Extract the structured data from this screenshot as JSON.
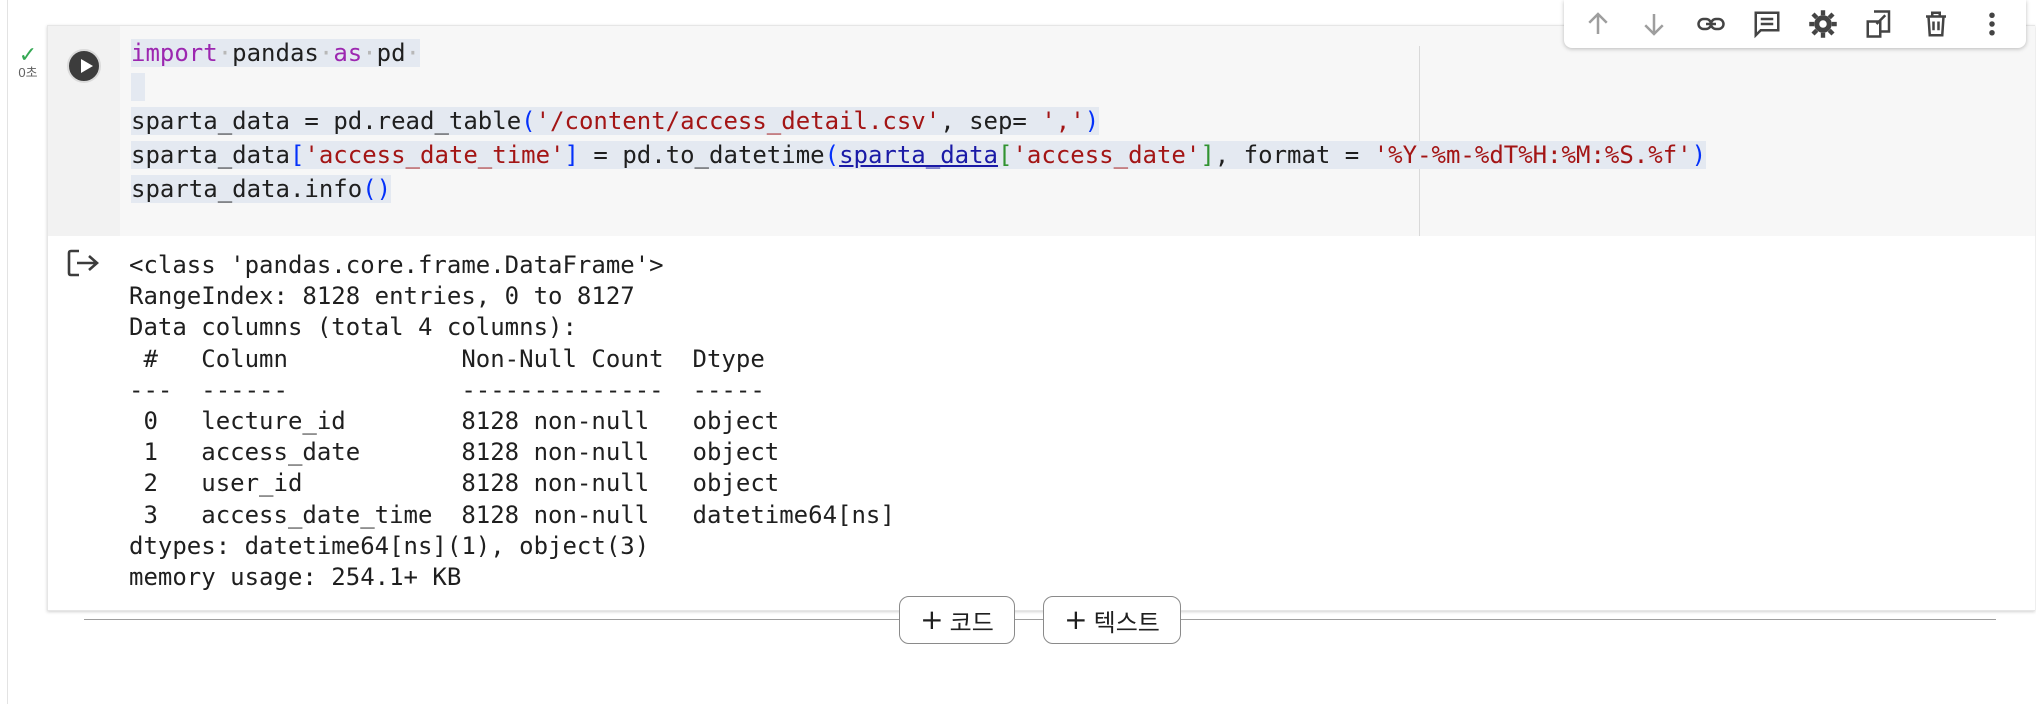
{
  "execution": {
    "status_glyph": "✓",
    "time": "0초"
  },
  "toolbar": {
    "items": [
      {
        "name": "move-up-icon"
      },
      {
        "name": "move-down-icon"
      },
      {
        "name": "link-icon"
      },
      {
        "name": "comment-icon"
      },
      {
        "name": "settings-icon"
      },
      {
        "name": "mirror-cell-icon"
      },
      {
        "name": "delete-icon"
      },
      {
        "name": "more-icon"
      }
    ]
  },
  "code": {
    "line1": {
      "kw1": "import",
      "mod": "pandas",
      "kw2": "as",
      "alias": "pd"
    },
    "line3": {
      "var": "sparta_data",
      "eq": " = ",
      "call": "pd.read_table",
      "open": "(",
      "str1": "'/content/access_detail.csv'",
      "mid": ", sep= ",
      "str2": "','",
      "close": ")"
    },
    "line4": {
      "var": "sparta_data",
      "b1": "[",
      "key": "'access_date_time'",
      "b2": "]",
      "eq": " = ",
      "call": "pd.to_datetime",
      "open": "(",
      "arg": "sparta_data",
      "b3": "[",
      "key2": "'access_date'",
      "b4": "]",
      "mid": ", format = ",
      "fmt": "'%Y-%m-%dT%H:%M:%S.%f'",
      "close": ")"
    },
    "line5": {
      "call": "sparta_data.info",
      "parens": "()"
    }
  },
  "output": {
    "lines": [
      "<class 'pandas.core.frame.DataFrame'>",
      "RangeIndex: 8128 entries, 0 to 8127",
      "Data columns (total 4 columns):",
      " #   Column            Non-Null Count  Dtype",
      "---  ------            --------------  -----",
      " 0   lecture_id        8128 non-null   object",
      " 1   access_date       8128 non-null   object",
      " 2   user_id           8128 non-null   object",
      " 3   access_date_time  8128 non-null   datetime64[ns]",
      "dtypes: datetime64[ns](1), object(3)",
      "memory usage: 254.1+ KB"
    ]
  },
  "add_buttons": {
    "code_label": "코드",
    "text_label": "텍스트",
    "plus": "+"
  }
}
